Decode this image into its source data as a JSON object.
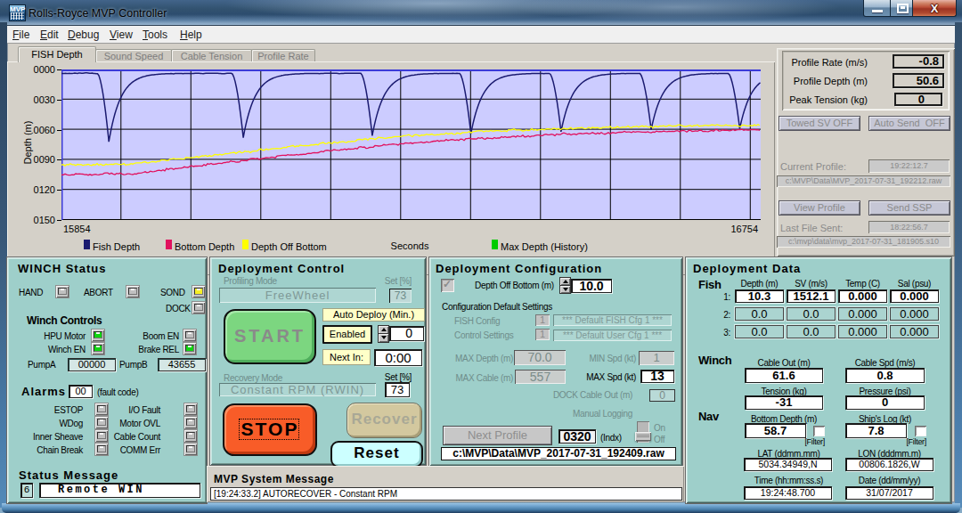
{
  "window": {
    "title": "Rolls-Royce MVP Controller",
    "icon_text": "MVP",
    "close_glyph": "X"
  },
  "menu": {
    "items": [
      "File",
      "Edit",
      "Debug",
      "View",
      "Tools",
      "Help"
    ]
  },
  "tabs": {
    "items": [
      "FISH Depth",
      "Sound Speed",
      "Cable Tension",
      "Profile Rate"
    ],
    "active": "FISH Depth"
  },
  "chart_data": {
    "type": "line",
    "title": "",
    "xlabel": "Seconds",
    "ylabel": "Depth (m)",
    "xlim": [
      15854,
      16754
    ],
    "ylim": [
      0,
      150
    ],
    "y_inverted": true,
    "x_tick_labels": [
      "15854",
      "16754"
    ],
    "y_tick_labels": [
      "0000",
      "0030",
      "0060",
      "0090",
      "0120",
      "0150"
    ],
    "x_grid_start": 15930,
    "x_grid_step": 90,
    "y_grid_step": 30,
    "plot_bg": "#ccccff",
    "frame_color": "#3b3bd8",
    "legend": [
      {
        "label": "Fish Depth",
        "color": "#1b1b70"
      },
      {
        "label": "Bottom Depth",
        "color": "#e1115e"
      },
      {
        "label": "Depth Off Bottom",
        "color": "#ffff00"
      },
      {
        "label": "Max Depth (History)",
        "color": "#00cc00"
      }
    ],
    "series": [
      {
        "name": "Fish Depth",
        "color": "#1b1b70",
        "type": "profiling",
        "surface_depth": 3.8,
        "dips": [
          [
            15915,
            72
          ],
          [
            16088,
            68
          ],
          [
            16254,
            66
          ],
          [
            16381,
            64
          ],
          [
            16497,
            62
          ],
          [
            16613,
            60
          ],
          [
            16727,
            59
          ]
        ]
      },
      {
        "name": "Bottom Depth",
        "color": "#e1115e",
        "type": "keypoints",
        "points": [
          [
            15854,
            105
          ],
          [
            15947,
            103.5
          ],
          [
            16061,
            93
          ],
          [
            16176,
            83
          ],
          [
            16291,
            74
          ],
          [
            16405,
            68
          ],
          [
            16520,
            64
          ],
          [
            16635,
            61.5
          ],
          [
            16754,
            60.3
          ]
        ]
      },
      {
        "name": "Depth Off Bottom",
        "color": "#ffff00",
        "type": "keypoints",
        "points": [
          [
            15854,
            95
          ],
          [
            15947,
            94
          ],
          [
            16061,
            84.5
          ],
          [
            16176,
            75
          ],
          [
            16291,
            66.5
          ],
          [
            16405,
            61.5
          ],
          [
            16520,
            58.5
          ],
          [
            16635,
            56.5
          ],
          [
            16754,
            55.5
          ]
        ]
      },
      {
        "name": "Max Depth (History)",
        "color": "#00cc00",
        "type": "hidden",
        "points": []
      }
    ]
  },
  "profile_panel": {
    "rows": [
      {
        "label": "Profile Rate (m/s)",
        "value": "-0.8"
      },
      {
        "label": "Profile Depth (m)",
        "value": "50.6"
      },
      {
        "label": "Peak Tension (kg)",
        "value": "0"
      }
    ],
    "towed_sv": "Towed SV OFF",
    "auto_send": "Auto Send  OFF",
    "view_profile": "View Profile",
    "send_ssp": "Send SSP",
    "current_profile_label": "Current Profile:",
    "current_profile_time": "19:22:12.7",
    "current_profile_file": "c:\\MVP\\Data\\MVP_2017-07-31_192212.raw",
    "last_file_label": "Last File Sent:",
    "last_file_time": "18:22:56.7",
    "last_file_file": "c:\\mvp\\data\\mvp_2017-07-31_181905.s10"
  },
  "winch_status": {
    "title": "WINCH Status",
    "hand": {
      "label": "HAND",
      "state": "off"
    },
    "abort": {
      "label": "ABORT",
      "state": "off"
    },
    "sond": {
      "label": "SOND",
      "state": "yellow"
    },
    "dock": {
      "label": "DOCK",
      "state": "off"
    },
    "controls_title": "Winch Controls",
    "hpu": {
      "label": "HPU Motor",
      "state": "green"
    },
    "boom": {
      "label": "Boom EN",
      "state": "off"
    },
    "winch_en": {
      "label": "Winch EN",
      "state": "green"
    },
    "brake": {
      "label": "Brake REL",
      "state": "green"
    },
    "pump_a": {
      "label": "PumpA",
      "value": "00000"
    },
    "pump_b": {
      "label": "PumpB",
      "value": "43655"
    },
    "alarms_title": "Alarms",
    "fault_code": "00",
    "fault_note": "(fault code)",
    "estop": {
      "label": "ESTOP",
      "state": "off"
    },
    "io_fault": {
      "label": "I/O Fault",
      "state": "off"
    },
    "wdog": {
      "label": "WDog",
      "state": "off"
    },
    "motor_ovl": {
      "label": "Motor OVL",
      "state": "off"
    },
    "inner_sheave": {
      "label": "Inner Sheave",
      "state": "off"
    },
    "cable_count": {
      "label": "Cable Count",
      "state": "off"
    },
    "chain_break": {
      "label": "Chain Break",
      "state": "off"
    },
    "comm_err": {
      "label": "COMM Err",
      "state": "off"
    },
    "status_title": "Status Message",
    "status_code": "6",
    "status_text": "Remote WIN"
  },
  "deployment_control": {
    "title": "Deployment Control",
    "profiling_mode_label": "Profiling Mode",
    "set_pct_label": "Set [%]",
    "profiling_mode": "FreeWheel",
    "profiling_set_pct": "73",
    "auto_deploy_label": "Auto Deploy (Min.)",
    "start_label": "START",
    "enabled_label": "Enabled",
    "auto_deploy_value": "0",
    "next_in_label": "Next In:",
    "next_in_value": "0:00",
    "recovery_mode_label": "Recovery Mode",
    "recovery_set_label": "Set [%]",
    "recovery_mode": "Constant RPM (RWIN)",
    "recovery_set_pct": "73",
    "stop_label": "STOP",
    "recover_label": "Recover",
    "reset_label": "Reset"
  },
  "deployment_configuration": {
    "title": "Deployment Configuration",
    "depth_off_bottom_label": "Depth Off Bottom (m)",
    "depth_off_bottom_value": "10.0",
    "config_default_label": "Configuration Default Settings",
    "fish_config_label": "FISH Config",
    "fish_config_num": "1",
    "fish_config_text": "*** Default FISH Cfg 1 ***",
    "control_settings_label": "Control Settings",
    "control_settings_num": "1",
    "control_settings_text": "*** Default User Cfg 1 ***",
    "max_depth_label": "MAX Depth (m)",
    "max_depth_value": "70.0",
    "min_spd_label": "MIN Spd (kt)",
    "min_spd_value": "1",
    "max_cable_label": "MAX Cable (m)",
    "max_cable_value": "557",
    "max_spd_label": "MAX Spd (kt)",
    "max_spd_value": "13",
    "dock_cable_label": "DOCK Cable Out (m)",
    "dock_cable_value": "0",
    "manual_logging_label": "Manual Logging",
    "toggle_on": "On",
    "toggle_off": "Off",
    "next_profile_label": "Next Profile",
    "next_profile_index": "0320",
    "index_label": "(Indx)",
    "next_profile_file": "c:\\MVP\\Data\\MVP_2017-07-31_192409.raw"
  },
  "deployment_data": {
    "title": "Deployment Data",
    "fish_label": "Fish",
    "columns": [
      "Depth (m)",
      "SV (m/s)",
      "Temp (C)",
      "Sal (psu)"
    ],
    "rows": [
      {
        "label": "1:",
        "values": [
          "10.3",
          "1512.1",
          "0.000",
          "0.000"
        ],
        "active": true
      },
      {
        "label": "2:",
        "values": [
          "0.0",
          "0.0",
          "0.000",
          "0.000"
        ],
        "active": false
      },
      {
        "label": "3:",
        "values": [
          "0.0",
          "0.0",
          "0.000",
          "0.000"
        ],
        "active": false
      }
    ],
    "winch_label": "Winch",
    "cable_out_label": "Cable Out (m)",
    "cable_out": "61.6",
    "cable_spd_label": "Cable Spd (m/s)",
    "cable_spd": "0.8",
    "tension_label": "Tension (kg)",
    "tension": "-31",
    "pressure_label": "Pressure (psi)",
    "pressure": "0",
    "nav_label": "Nav",
    "bottom_depth_label": "Bottom Depth (m)",
    "bottom_depth": "58.7",
    "ships_log_label": "Ship's Log (kt)",
    "ships_log": "7.8",
    "filter_label": "[Filter]",
    "lat_label": "LAT (ddmm.mm)",
    "lat": "5034.34949,N",
    "lon_label": "LON (dddmm.m)",
    "lon": "00806.1826,W",
    "time_label": "Time (hh:mm:ss.s)",
    "time": "19:24:48.700",
    "date_label": "Date (dd/mm/yy)",
    "date": "31/07/2017"
  },
  "system_message": {
    "title": "MVP System Message",
    "text": "[19:24:33.2] AUTORECOVER - Constant RPM"
  }
}
